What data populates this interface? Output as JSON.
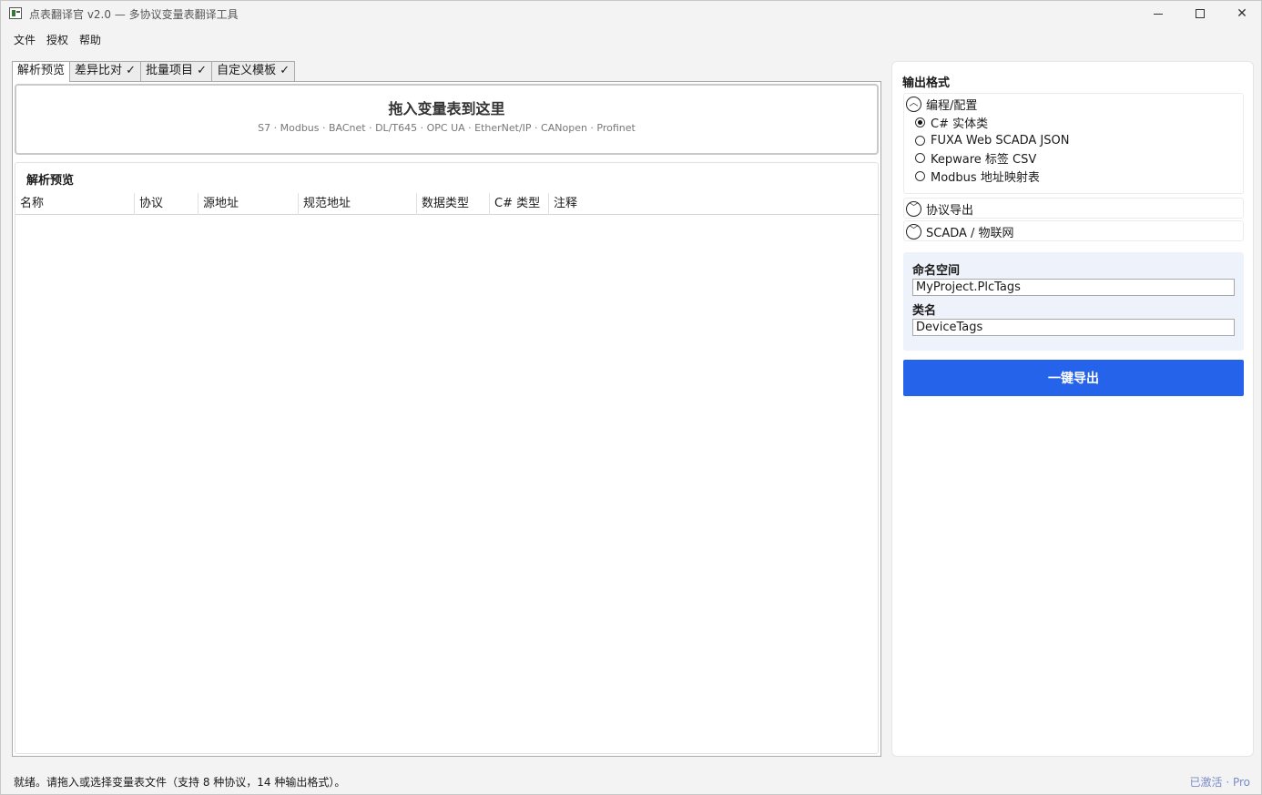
{
  "window": {
    "title": "点表翻译官 v2.0 — 多协议变量表翻译工具"
  },
  "menu": [
    "文件",
    "授权",
    "帮助"
  ],
  "tabs": [
    "解析预览",
    "差异比对 ✓",
    "批量项目 ✓",
    "自定义模板 ✓"
  ],
  "dropzone": {
    "title": "拖入变量表到这里",
    "protocols": "S7 · Modbus · BACnet · DL/T645 · OPC UA · EtherNet/IP · CANopen · Profinet"
  },
  "preview": {
    "title": "解析预览",
    "columns": [
      "名称",
      "协议",
      "源地址",
      "规范地址",
      "数据类型",
      "C# 类型",
      "注释"
    ]
  },
  "output": {
    "title": "输出格式",
    "groups": [
      {
        "label": "编程/配置",
        "expanded": true,
        "options": [
          "C# 实体类",
          "FUXA Web SCADA JSON",
          "Kepware 标签 CSV",
          "Modbus 地址映射表"
        ],
        "selected": "C# 实体类"
      },
      {
        "label": "协议导出",
        "expanded": false
      },
      {
        "label": "SCADA / 物联网",
        "expanded": false
      }
    ]
  },
  "naming": {
    "namespace_label": "命名空间",
    "namespace_value": "MyProject.PlcTags",
    "class_label": "类名",
    "class_value": "DeviceTags"
  },
  "export_button": "一键导出",
  "status": {
    "message": "就绪。请拖入或选择变量表文件（支持 8 种协议，14 种输出格式）。",
    "license": "已激活 · Pro"
  },
  "colors": {
    "accent": "#2563eb",
    "naming_bg": "#eef2fa",
    "license_text": "#7a8cc8"
  }
}
